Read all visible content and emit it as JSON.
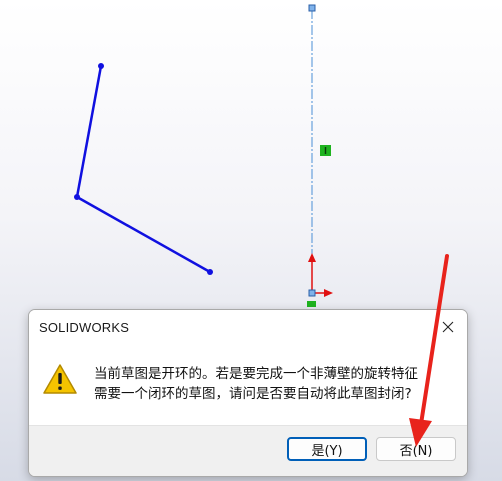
{
  "dialog": {
    "title": "SOLIDWORKS",
    "message_lines": [
      "当前草图是开环的。若是要完成一个非薄壁的旋转特征",
      "需要一个闭环的草图，请问是否要自动将此草图封闭?"
    ],
    "yes_label": "是(Y)",
    "no_label": "否(N)"
  },
  "colors": {
    "sketch_line": "#1010e0",
    "centerline": "#4a8fd6",
    "relation_marker": "#1fb31f",
    "origin_arrow": "#e01010",
    "annotation_arrow": "#e8231c",
    "default_button_border": "#005fb8",
    "warning_fill": "#f5c400"
  },
  "icons": {
    "warning": "warning-icon",
    "close": "close-icon",
    "origin": "origin-icon"
  }
}
